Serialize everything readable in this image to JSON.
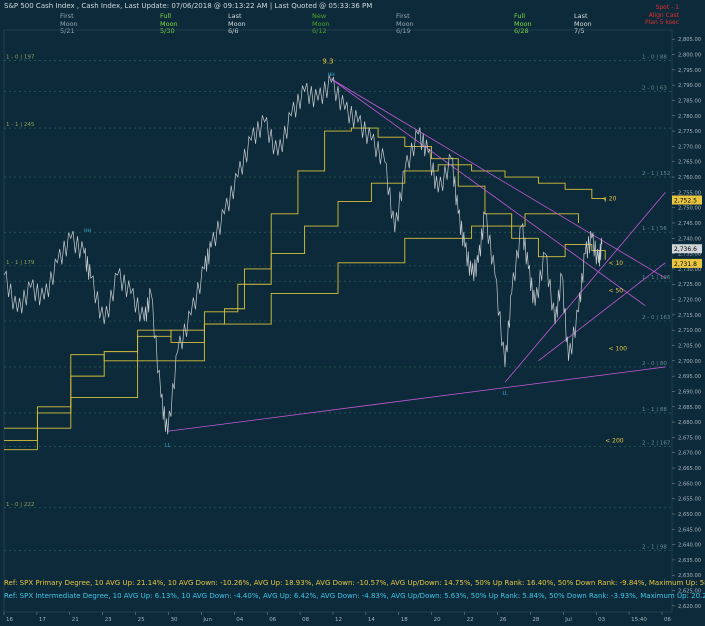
{
  "title": "S&P 500 Cash Index , Cash Index, Last Update: 07/06/2018 @ 09:13:22 AM | Last Quoted @ 05:33:36 PM",
  "moon_labels": [
    {
      "phase": "First",
      "moon": "Moon",
      "date": "5/21",
      "color": "#9aa8b0"
    },
    {
      "phase": "Full",
      "moon": "Moon",
      "date": "5/30",
      "color": "#7fdc3a"
    },
    {
      "phase": "Last",
      "moon": "Moon",
      "date": "6/6",
      "color": "#d8dde0"
    },
    {
      "phase": "New",
      "moon": "Moon",
      "date": "6/12",
      "color": "#4aa62a"
    },
    {
      "phase": "First",
      "moon": "Moon",
      "date": "6/19",
      "color": "#9aa8b0"
    },
    {
      "phase": "Full",
      "moon": "Moon",
      "date": "6/28",
      "color": "#7fdc3a"
    },
    {
      "phase": "Last",
      "moon": "Moon",
      "date": "7/5",
      "color": "#d8dde0"
    }
  ],
  "corner": {
    "line1": "Spot - 1",
    "line2": "Align Cast",
    "line3": "Plan 5 ksec"
  },
  "footer": {
    "primary": "Ref: SPX Primary Degree, 10 AVG Up: 21.14%, 10 AVG Down: -10.26%, AVG Up: 18.93%, AVG Down: -10.57%, AVG Up/Down: 14.75%, 50%  Up Rank: 16.40%, 50% Down Rank: -9.84%, Maximum Up: 58.71%, Maximum",
    "intermediate": "Ref: SPX Intermediate Degree, 10 AVG Up: 6.13%, 10 AVG Down: -4.40%, AVG Up: 6.42%, AVG Down: -4.83%, AVG Up/Down: 5.63%, 50%  Up Rank: 5.84%, 50% Down Rank: -3.93%, Maximum Up: 20.27%, Maximum Do"
  },
  "chart_data": {
    "type": "line",
    "y_ticks": [
      2620,
      2625,
      2630,
      2635,
      2640,
      2645,
      2650,
      2655,
      2660,
      2665,
      2670,
      2675,
      2680,
      2685,
      2690,
      2695,
      2700,
      2705,
      2710,
      2715,
      2720,
      2725,
      2730,
      2735,
      2740,
      2745,
      2750,
      2755,
      2760,
      2765,
      2770,
      2775,
      2780,
      2785,
      2790,
      2795,
      2800,
      2805
    ],
    "ylim": [
      2618,
      2808
    ],
    "x_ticks": [
      "16",
      "17",
      "21",
      "23",
      "25",
      "30",
      "Jun",
      "04",
      "06",
      "08",
      "12",
      "14",
      "18",
      "20",
      "22",
      "26",
      "28",
      "Jul",
      "03",
      "15:40",
      "06"
    ],
    "price_labels": [
      {
        "text": "2,752.5",
        "value": 2752.5,
        "bg": "#e8c640"
      },
      {
        "text": "2,736.6",
        "value": 2736.6,
        "bg": "#cfd5d8"
      },
      {
        "text": "2,731.8",
        "value": 2731.8,
        "bg": "#e8c640"
      }
    ],
    "fib_levels": [
      {
        "label": "1 - 0 | 197",
        "value": 2798,
        "side": "left"
      },
      {
        "label": "1 - 0 | 88",
        "value": 2798,
        "side": "right"
      },
      {
        "label": "2 - 0 | 63",
        "value": 2788,
        "side": "right"
      },
      {
        "label": "1 - 1 | 245",
        "value": 2776,
        "side": "left"
      },
      {
        "label": "2 - 1 | 152",
        "value": 2760,
        "side": "right"
      },
      {
        "label": "1 - 1 | 56",
        "value": 2742,
        "side": "right"
      },
      {
        "label": "1 - 1 | 179",
        "value": 2731,
        "side": "left"
      },
      {
        "label": "1 - 1 | 196",
        "value": 2726,
        "side": "right"
      },
      {
        "label": "2 - 0 | 163",
        "value": 2713,
        "side": "right"
      },
      {
        "label": "2 - 0 | 80",
        "value": 2698,
        "side": "right"
      },
      {
        "label": "1 - 1 | 88",
        "value": 2683,
        "side": "right"
      },
      {
        "label": "2 - 2 | 167",
        "value": 2672,
        "side": "right"
      },
      {
        "label": "1 - 0 | 222",
        "value": 2652,
        "side": "left"
      },
      {
        "label": "2 - 1 | 98",
        "value": 2638,
        "side": "right"
      }
    ],
    "ma_labels": [
      {
        "text": "< 20",
        "value": 2753
      },
      {
        "text": "< 10",
        "value": 2732
      },
      {
        "text": "< 50",
        "value": 2723
      },
      {
        "text": "< 100",
        "value": 2704
      },
      {
        "text": "< 200",
        "value": 2674
      }
    ],
    "annotations": [
      {
        "text": "9.3",
        "x": 0.485,
        "value": 2797
      }
    ],
    "price_path": [
      [
        0.0,
        2728
      ],
      [
        0.02,
        2716
      ],
      [
        0.04,
        2724
      ],
      [
        0.06,
        2720
      ],
      [
        0.08,
        2732
      ],
      [
        0.1,
        2740
      ],
      [
        0.12,
        2735
      ],
      [
        0.13,
        2727
      ],
      [
        0.15,
        2712
      ],
      [
        0.17,
        2728
      ],
      [
        0.19,
        2722
      ],
      [
        0.21,
        2713
      ],
      [
        0.22,
        2722
      ],
      [
        0.235,
        2688
      ],
      [
        0.245,
        2676
      ],
      [
        0.26,
        2703
      ],
      [
        0.28,
        2715
      ],
      [
        0.3,
        2730
      ],
      [
        0.31,
        2737
      ],
      [
        0.33,
        2748
      ],
      [
        0.35,
        2760
      ],
      [
        0.37,
        2772
      ],
      [
        0.39,
        2778
      ],
      [
        0.41,
        2767
      ],
      [
        0.43,
        2780
      ],
      [
        0.45,
        2788
      ],
      [
        0.47,
        2785
      ],
      [
        0.49,
        2791
      ],
      [
        0.51,
        2782
      ],
      [
        0.53,
        2778
      ],
      [
        0.55,
        2772
      ],
      [
        0.57,
        2765
      ],
      [
        0.585,
        2742
      ],
      [
        0.6,
        2762
      ],
      [
        0.62,
        2774
      ],
      [
        0.635,
        2768
      ],
      [
        0.65,
        2755
      ],
      [
        0.67,
        2766
      ],
      [
        0.68,
        2748
      ],
      [
        0.69,
        2737
      ],
      [
        0.7,
        2728
      ],
      [
        0.71,
        2732
      ],
      [
        0.72,
        2748
      ],
      [
        0.735,
        2728
      ],
      [
        0.75,
        2698
      ],
      [
        0.76,
        2722
      ],
      [
        0.775,
        2744
      ],
      [
        0.785,
        2730
      ],
      [
        0.795,
        2718
      ],
      [
        0.81,
        2735
      ],
      [
        0.825,
        2712
      ],
      [
        0.835,
        2728
      ],
      [
        0.845,
        2700
      ],
      [
        0.86,
        2716
      ],
      [
        0.87,
        2735
      ],
      [
        0.88,
        2740
      ],
      [
        0.89,
        2732
      ],
      [
        0.895,
        2738
      ]
    ],
    "ma_lines": [
      {
        "name": "< 10",
        "color": "#d8c23a",
        "points": [
          [
            0.0,
            2671
          ],
          [
            0.05,
            2683
          ],
          [
            0.1,
            2702
          ],
          [
            0.15,
            2700
          ],
          [
            0.2,
            2710
          ],
          [
            0.25,
            2706
          ],
          [
            0.3,
            2712
          ],
          [
            0.33,
            2717
          ],
          [
            0.36,
            2730
          ],
          [
            0.4,
            2748
          ],
          [
            0.44,
            2762
          ],
          [
            0.48,
            2775
          ],
          [
            0.52,
            2776
          ],
          [
            0.56,
            2773
          ],
          [
            0.6,
            2770
          ],
          [
            0.64,
            2766
          ],
          [
            0.68,
            2757
          ],
          [
            0.72,
            2748
          ],
          [
            0.76,
            2740
          ],
          [
            0.8,
            2734
          ],
          [
            0.84,
            2738
          ],
          [
            0.88,
            2736
          ],
          [
            0.9,
            2733
          ]
        ]
      },
      {
        "name": "< 20",
        "color": "#d8c23a",
        "points": [
          [
            0.0,
            2674
          ],
          [
            0.05,
            2685
          ],
          [
            0.1,
            2695
          ],
          [
            0.15,
            2703
          ],
          [
            0.2,
            2708
          ],
          [
            0.25,
            2710
          ],
          [
            0.3,
            2716
          ],
          [
            0.35,
            2725
          ],
          [
            0.4,
            2735
          ],
          [
            0.45,
            2744
          ],
          [
            0.5,
            2752
          ],
          [
            0.55,
            2758
          ],
          [
            0.6,
            2762
          ],
          [
            0.65,
            2764
          ],
          [
            0.7,
            2762
          ],
          [
            0.75,
            2760
          ],
          [
            0.8,
            2758
          ],
          [
            0.84,
            2756
          ],
          [
            0.88,
            2753
          ],
          [
            0.9,
            2752
          ]
        ]
      },
      {
        "name": "< 50",
        "color": "#d8c23a",
        "points": [
          [
            0.0,
            2678
          ],
          [
            0.1,
            2688
          ],
          [
            0.2,
            2700
          ],
          [
            0.3,
            2712
          ],
          [
            0.4,
            2722
          ],
          [
            0.5,
            2732
          ],
          [
            0.6,
            2740
          ],
          [
            0.7,
            2744
          ],
          [
            0.78,
            2748
          ],
          [
            0.86,
            2745
          ]
        ]
      }
    ],
    "trend_lines": [
      {
        "color": "#c05ad6",
        "points": [
          [
            0.245,
            2677
          ],
          [
            0.99,
            2698
          ]
        ]
      },
      {
        "color": "#c05ad6",
        "points": [
          [
            0.49,
            2792
          ],
          [
            0.99,
            2727
          ]
        ]
      },
      {
        "color": "#c05ad6",
        "points": [
          [
            0.49,
            2792
          ],
          [
            0.96,
            2718
          ]
        ]
      },
      {
        "color": "#c05ad6",
        "points": [
          [
            0.75,
            2693
          ],
          [
            0.99,
            2755
          ]
        ]
      },
      {
        "color": "#c05ad6",
        "points": [
          [
            0.8,
            2700
          ],
          [
            0.99,
            2732
          ]
        ]
      }
    ],
    "pivot_marks": [
      {
        "text": "HH",
        "x": 0.49,
        "value": 2792
      },
      {
        "text": "HH",
        "x": 0.125,
        "value": 2741
      },
      {
        "text": "LL",
        "x": 0.245,
        "value": 2675
      },
      {
        "text": "LL",
        "x": 0.75,
        "value": 2692
      }
    ]
  }
}
